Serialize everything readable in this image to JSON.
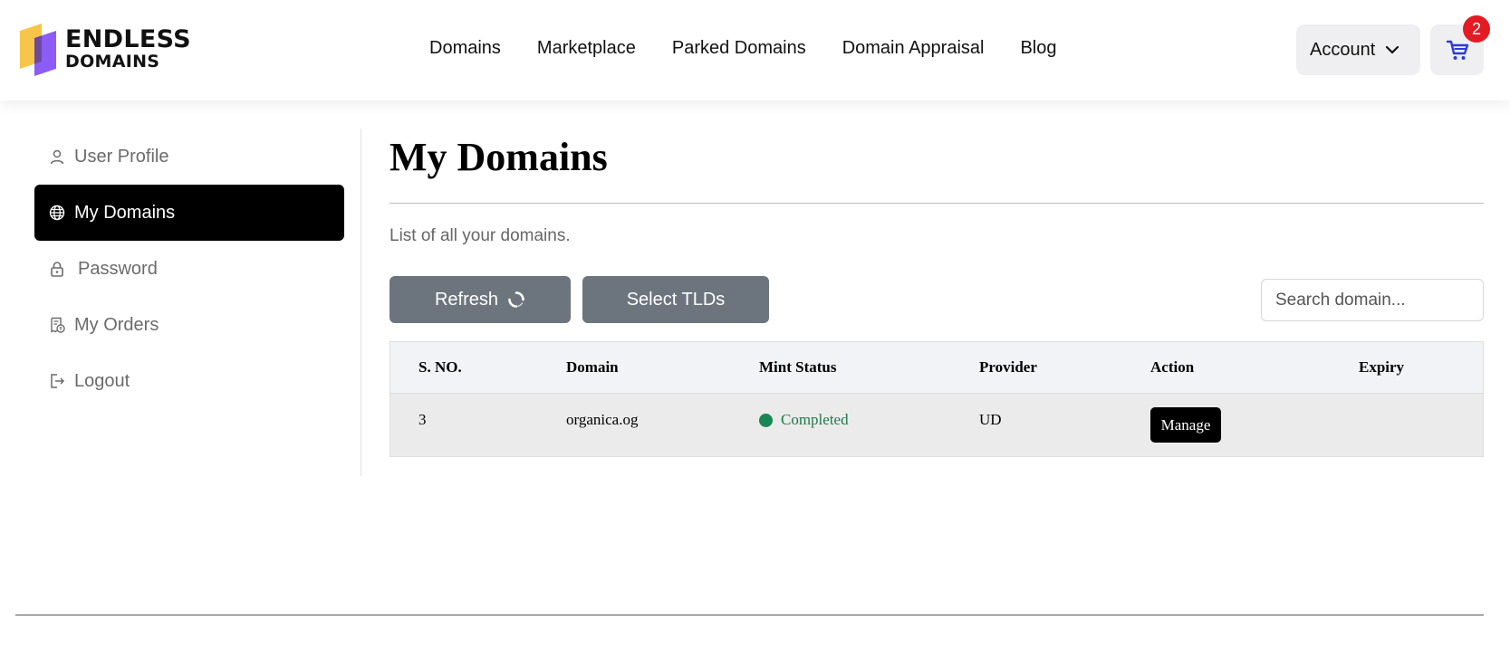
{
  "brand": {
    "line1": "ENDLESS",
    "line2": "DOMAINS"
  },
  "nav": [
    {
      "label": "Domains"
    },
    {
      "label": "Marketplace"
    },
    {
      "label": "Parked Domains"
    },
    {
      "label": "Domain Appraisal"
    },
    {
      "label": "Blog"
    }
  ],
  "account": {
    "label": "Account"
  },
  "cart": {
    "count": "2"
  },
  "sidebar": {
    "items": [
      {
        "label": "User Profile",
        "icon": "user-icon"
      },
      {
        "label": "My Domains",
        "icon": "globe-icon",
        "active": true
      },
      {
        "label": "Password",
        "icon": "lock-icon"
      },
      {
        "label": "My Orders",
        "icon": "receipt-icon"
      },
      {
        "label": "Logout",
        "icon": "logout-icon"
      }
    ]
  },
  "main": {
    "title": "My Domains",
    "subtitle": "List of all your domains.",
    "refresh_label": "Refresh",
    "select_tlds_label": "Select TLDs",
    "search_placeholder": "Search domain..."
  },
  "table": {
    "columns": [
      "S. NO.",
      "Domain",
      "Mint Status",
      "Provider",
      "Action",
      "Expiry"
    ],
    "rows": [
      {
        "sno": "3",
        "domain": "organica.og",
        "status": "Completed",
        "provider": "UD",
        "action": "Manage",
        "expiry": ""
      }
    ]
  },
  "colors": {
    "active_bg": "#000000",
    "button_gray": "#6c757d",
    "status_green": "#198754",
    "badge_red": "#e31b23",
    "cart_blue": "#2f3bd6"
  }
}
